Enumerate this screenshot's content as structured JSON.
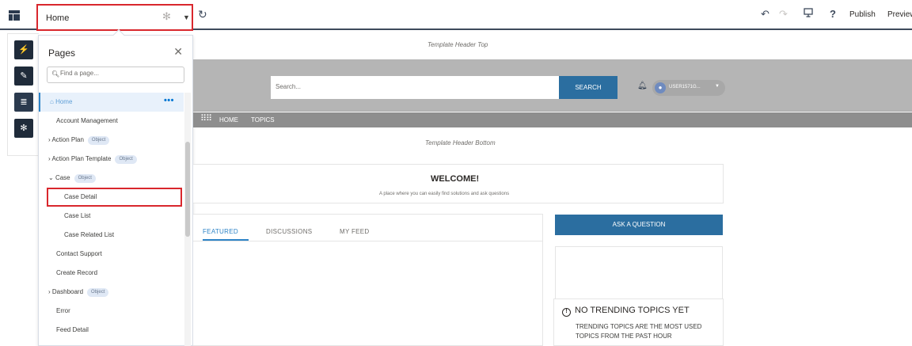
{
  "toolbar": {
    "page_selector": "Home",
    "publish": "Publish",
    "preview": "Preview"
  },
  "pages_panel": {
    "title": "Pages",
    "search_placeholder": "Find a page...",
    "items": [
      {
        "label": "Home",
        "badge": ""
      },
      {
        "label": "Account Management",
        "badge": ""
      },
      {
        "label": "Action Plan",
        "badge": "Object"
      },
      {
        "label": "Action Plan Template",
        "badge": "Object"
      },
      {
        "label": "Case",
        "badge": "Object"
      },
      {
        "label": "Case Detail",
        "badge": ""
      },
      {
        "label": "Case List",
        "badge": ""
      },
      {
        "label": "Case Related List",
        "badge": ""
      },
      {
        "label": "Contact Support",
        "badge": ""
      },
      {
        "label": "Create Record",
        "badge": ""
      },
      {
        "label": "Dashboard",
        "badge": "Object"
      },
      {
        "label": "Error",
        "badge": ""
      },
      {
        "label": "Feed Detail",
        "badge": ""
      }
    ]
  },
  "canvas": {
    "header_top": "Template Header Top",
    "search_placeholder": "Search...",
    "search_button": "SEARCH",
    "user_name": "USER1571G...",
    "nav": [
      "HOME",
      "TOPICS"
    ],
    "header_bottom": "Template Header Bottom",
    "welcome_title": "WELCOME!",
    "welcome_subtitle": "A place where you can easily find solutions and ask questions",
    "tabs": [
      "FEATURED",
      "DISCUSSIONS",
      "MY FEED"
    ],
    "ask_button": "ASK A QUESTION",
    "trending_title": "NO TRENDING TOPICS YET",
    "trending_desc": "TRENDING TOPICS ARE THE MOST USED TOPICS FROM THE PAST HOUR"
  }
}
